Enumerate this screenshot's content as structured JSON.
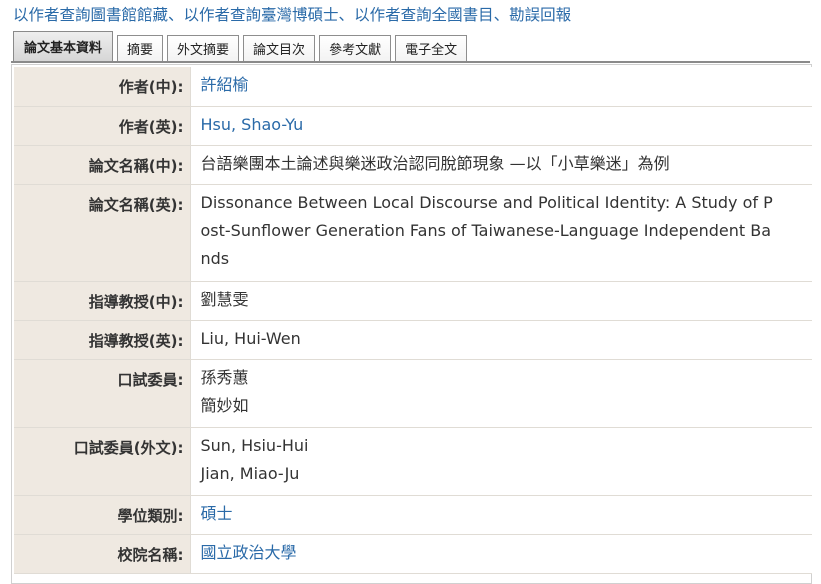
{
  "top_links": [
    "以作者查詢圖書館館藏",
    "以作者查詢臺灣博碩士",
    "以作者查詢全國書目",
    "勘誤回報"
  ],
  "separator": "、",
  "tabs": [
    {
      "label": "論文基本資料",
      "active": true
    },
    {
      "label": "摘要",
      "active": false
    },
    {
      "label": "外文摘要",
      "active": false
    },
    {
      "label": "論文目次",
      "active": false
    },
    {
      "label": "參考文獻",
      "active": false
    },
    {
      "label": "電子全文",
      "active": false
    }
  ],
  "fields": {
    "author_zh": {
      "label": "作者(中):",
      "value": "許紹榆"
    },
    "author_en": {
      "label": "作者(英):",
      "value": "Hsu, Shao-Yu"
    },
    "title_zh": {
      "label": "論文名稱(中):",
      "value": "台語樂團本土論述與樂迷政治認同脫節現象 —以「小草樂迷」為例"
    },
    "title_en": {
      "label": "論文名稱(英):",
      "lines": [
        "Dissonance Between Local Discourse and Political Identity: A Study of P",
        "ost-Sunflower Generation Fans of Taiwanese-Language Independent Ba",
        "nds"
      ]
    },
    "advisor_zh": {
      "label": "指導教授(中):",
      "value": "劉慧雯"
    },
    "advisor_en": {
      "label": "指導教授(英):",
      "value": "Liu, Hui-Wen"
    },
    "committee": {
      "label": "口試委員:",
      "lines": [
        "孫秀蕙",
        "簡妙如"
      ]
    },
    "committee_en": {
      "label": "口試委員(外文):",
      "lines": [
        "Sun, Hsiu-Hui",
        "Jian, Miao-Ju"
      ]
    },
    "degree": {
      "label": "學位類別:",
      "value": "碩士"
    },
    "school": {
      "label": "校院名稱:",
      "value": "國立政治大學"
    }
  },
  "colors": {
    "link": "#2a6aa8",
    "label_bg": "#efe9e1",
    "border": "#e0dcd5"
  }
}
